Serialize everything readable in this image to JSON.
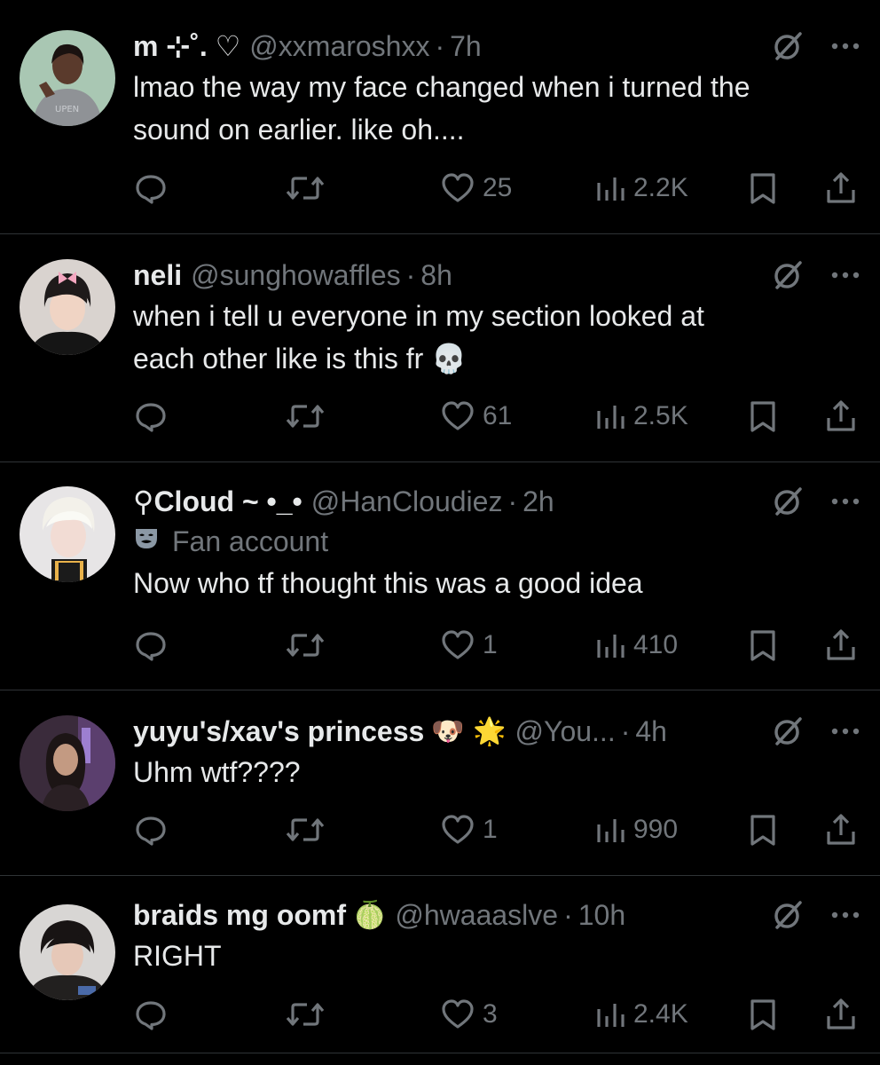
{
  "tweets": [
    {
      "display_name": "m ⊹˚. ♡",
      "name_emoji": "",
      "handle": "@xxmaroshxx",
      "time": "7h",
      "label": "",
      "text": "lmao the way my face changed when i turned the\nsound on earlier. like oh....",
      "likes": "25",
      "views": "2.2K",
      "avatar": "woman-grey-shirt"
    },
    {
      "display_name": "neli",
      "name_emoji": "",
      "handle": "@sunghowaffles",
      "time": "8h",
      "label": "",
      "text": "when i tell u everyone in my section looked at\neach other like is this fr 💀",
      "likes": "61",
      "views": "2.5K",
      "avatar": "person-with-bow"
    },
    {
      "display_name": "⚲Cloud ~ •_•",
      "name_emoji": "",
      "handle": "@HanCloudiez",
      "time": "2h",
      "label": "Fan account",
      "text": "Now who tf thought this was a good idea",
      "likes": "1",
      "views": "410",
      "avatar": "blond-person"
    },
    {
      "display_name": "yuyu's/xav's princess",
      "name_emoji": "🐶 🌟",
      "handle": "@You...",
      "time": "4h",
      "label": "",
      "text": "Uhm wtf????",
      "likes": "1",
      "views": "990",
      "avatar": "woman-selfie"
    },
    {
      "display_name": "braids mg oomf",
      "name_emoji": "🍈",
      "handle": "@hwaaaslve",
      "time": "10h",
      "label": "",
      "text": "RIGHT",
      "likes": "3",
      "views": "2.4K",
      "avatar": "person-dark-jacket"
    }
  ],
  "icons": {
    "grok": "grok-icon",
    "more": "more-icon",
    "reply": "reply-icon",
    "retweet": "retweet-icon",
    "like": "heart-icon",
    "views": "views-icon",
    "bookmark": "bookmark-icon",
    "share": "share-icon",
    "fan_label": "mask-icon"
  },
  "colors": {
    "background": "#000000",
    "text": "#e7e9ea",
    "secondary": "#71767b",
    "divider": "#2f3336"
  }
}
